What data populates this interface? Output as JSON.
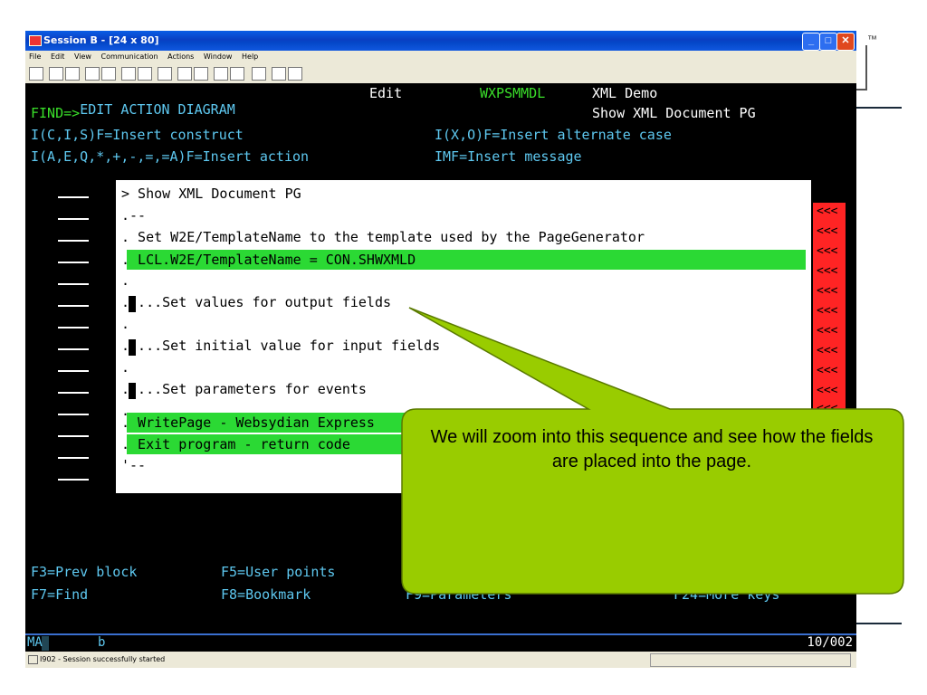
{
  "slide": {
    "trademark": "™"
  },
  "window": {
    "title": "Session B - [24 x 80]",
    "buttons": {
      "minimize": "_",
      "maximize": "□",
      "close": "✕"
    },
    "menu": [
      "File",
      "Edit",
      "View",
      "Communication",
      "Actions",
      "Window",
      "Help"
    ]
  },
  "screen": {
    "line1": {
      "left": "EDIT ACTION DIAGRAM",
      "mode": "Edit",
      "program": "WXPSMMDL",
      "title": "XML Demo"
    },
    "line2": {
      "find": "FIND=>",
      "subtitle": "Show XML Document PG"
    },
    "line3": {
      "left": "I(C,I,S)F=Insert construct",
      "right": "I(X,O)F=Insert alternate case"
    },
    "line4": {
      "left": "I(A,E,Q,*,+,-,=,=A)F=Insert action",
      "right": "IMF=Insert message"
    },
    "panel_lines": [
      "> Show XML Document PG",
      ".--",
      ". Set W2E/TemplateName to the template used by the PageGenerator",
      ". LCL.W2E/TemplateName = CON.SHWXMLD",
      ".",
      ". ...Set values for output fields",
      ".",
      ". ...Set initial value for input fields",
      ".",
      ". ...Set parameters for events",
      ".",
      ". WritePage - Websydian Express",
      ". Exit program - return code",
      "'--"
    ],
    "red_markers": [
      "<<<",
      "<<<",
      "<<<",
      "<<<",
      "<<<",
      "<<<",
      "<<<",
      "<<<",
      "<<<",
      "<<<",
      "<<<"
    ],
    "fkeys": {
      "row1": [
        "F3=Prev block",
        "F5=User points"
      ],
      "row2": [
        "F7=Find",
        "F8=Bookmark",
        "F9=Parameters",
        "F24=More keys"
      ]
    },
    "oia": {
      "mode": "MA",
      "indicator": "b",
      "cursor_pos": "10/002"
    }
  },
  "status_bar": {
    "message": "I902 - Session successfully started"
  },
  "callout": {
    "text": "We will zoom into this sequence and see how the fields are placed into the page."
  },
  "colors": {
    "terminal_bg": "#000000",
    "cyan": "#5ec8f0",
    "green": "#3ae02a",
    "highlight": "#2bd934",
    "marker_red": "#ff2424",
    "callout_fill": "#99cc00"
  }
}
